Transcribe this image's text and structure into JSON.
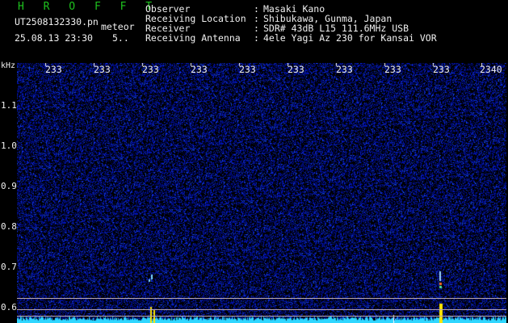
{
  "header": {
    "app_title": "H R O F F T",
    "filename": "UT2508132330.pn",
    "meteor_label": "meteor",
    "timestamp": "25.08.13 23:30",
    "count": "5..",
    "meta": [
      {
        "label": "Observer",
        "value": "Masaki Kano"
      },
      {
        "label": "Receiving Location",
        "value": "Shibukawa, Gunma, Japan"
      },
      {
        "label": "Receiver",
        "value": "SDR# 43dB L15 111.6MHz USB"
      },
      {
        "label": "Receiving Antenna",
        "value": "4ele Yagi Az 230 for Kansai VOR"
      }
    ],
    "colon": ":"
  },
  "axes": {
    "y_unit": "kHz",
    "y_ticks": [
      "1.1",
      "1.0",
      "0.9",
      "0.8",
      "0.7",
      "0.6"
    ],
    "x_ticks": [
      "233",
      "233",
      "233",
      "233",
      "233",
      "233",
      "233",
      "233",
      "233",
      "2340"
    ]
  },
  "colors": {
    "background": "#000000",
    "title_green": "#1ec21e",
    "text": "#f0f0f0",
    "noise_blue": "#1a2bd8",
    "spectrum_cyan": "#2fd6ff",
    "signal_yellow": "#ffe600"
  }
}
